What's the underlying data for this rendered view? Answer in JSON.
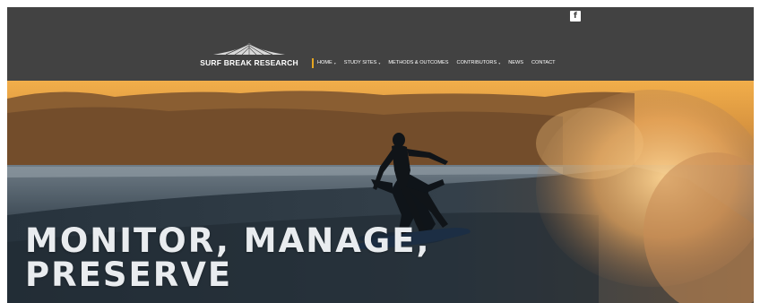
{
  "header": {
    "social": {
      "label": "f",
      "icon": "facebook-icon"
    },
    "logo": {
      "text": "SURF BREAK RESEARCH",
      "icon": "wave-logo-icon"
    },
    "nav": [
      {
        "label": "HOME",
        "has_submenu": true,
        "active": true
      },
      {
        "label": "STUDY SITES",
        "has_submenu": true,
        "active": false
      },
      {
        "label": "METHODS & OUTCOMES",
        "has_submenu": false,
        "active": false
      },
      {
        "label": "CONTRIBUTORS",
        "has_submenu": true,
        "active": false
      },
      {
        "label": "NEWS",
        "has_submenu": false,
        "active": false
      },
      {
        "label": "CONTACT",
        "has_submenu": false,
        "active": false
      }
    ],
    "colors": {
      "bar": "#424242",
      "accent": "#e5a620",
      "text": "#ffffff"
    }
  },
  "hero": {
    "headline_line1": "MONITOR, MANAGE,",
    "headline_line2": "PRESERVE",
    "image": "surfer-at-sunset-photo"
  }
}
